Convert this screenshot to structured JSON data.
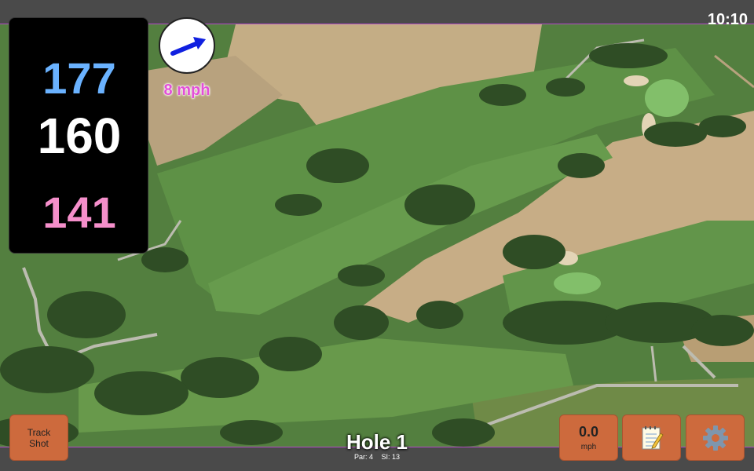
{
  "status": {
    "time": "10:10"
  },
  "yardage": {
    "back": "177",
    "middle": "160",
    "front": "141"
  },
  "wind": {
    "speed": "8 mph",
    "direction_icon": "wind-arrow-icon"
  },
  "hole": {
    "title": "Hole 1",
    "par": "Par: 4",
    "stroke_index": "SI: 13"
  },
  "buttons": {
    "track_shot": {
      "line1": "Track",
      "line2": "Shot"
    },
    "speed": {
      "value": "0.0",
      "unit": "mph"
    },
    "notes_icon": "notepad-icon",
    "settings_icon": "gear-icon"
  },
  "colors": {
    "back_yardage": "#6ab2ff",
    "middle_yardage": "#ffffff",
    "front_yardage": "#f58fcb",
    "button": "#cd6a3d",
    "wind_text": "#e34fd8"
  }
}
